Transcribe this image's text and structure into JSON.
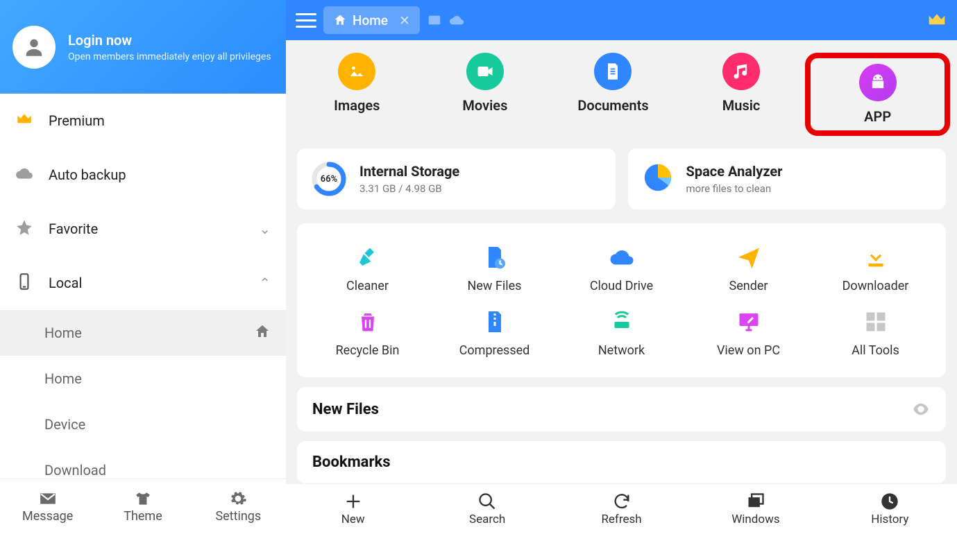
{
  "sidebar": {
    "login_title": "Login now",
    "login_sub": "Open members immediately enjoy all privileges",
    "items": [
      {
        "id": "premium",
        "label": "Premium"
      },
      {
        "id": "autobackup",
        "label": "Auto backup"
      },
      {
        "id": "favorite",
        "label": "Favorite"
      },
      {
        "id": "local",
        "label": "Local"
      }
    ],
    "local_children": [
      {
        "id": "home1",
        "label": "Home",
        "active": true
      },
      {
        "id": "home2",
        "label": "Home"
      },
      {
        "id": "device",
        "label": "Device"
      },
      {
        "id": "download",
        "label": "Download"
      }
    ],
    "footer": [
      {
        "id": "message",
        "label": "Message"
      },
      {
        "id": "theme",
        "label": "Theme"
      },
      {
        "id": "settings",
        "label": "Settings"
      }
    ]
  },
  "topbar": {
    "tab_label": "Home"
  },
  "categories": [
    {
      "id": "images",
      "label": "Images",
      "color": "#ffb300"
    },
    {
      "id": "movies",
      "label": "Movies",
      "color": "#18c99b"
    },
    {
      "id": "documents",
      "label": "Documents",
      "color": "#2f86ff"
    },
    {
      "id": "music",
      "label": "Music",
      "color": "#ff2d6b"
    },
    {
      "id": "app",
      "label": "APP",
      "color": "#c53cf0",
      "highlight": true
    }
  ],
  "storage": {
    "title": "Internal Storage",
    "used": "3.31 GB",
    "total": "4.98 GB",
    "sub": "3.31 GB / 4.98 GB",
    "percent": 66,
    "percent_label": "66%"
  },
  "analyzer": {
    "title": "Space Analyzer",
    "sub": "more files to clean"
  },
  "tools": [
    [
      {
        "id": "cleaner",
        "label": "Cleaner"
      },
      {
        "id": "newfiles",
        "label": "New Files"
      },
      {
        "id": "clouddrive",
        "label": "Cloud Drive"
      },
      {
        "id": "sender",
        "label": "Sender"
      },
      {
        "id": "downloader",
        "label": "Downloader"
      }
    ],
    [
      {
        "id": "recyclebin",
        "label": "Recycle Bin"
      },
      {
        "id": "compressed",
        "label": "Compressed"
      },
      {
        "id": "network",
        "label": "Network"
      },
      {
        "id": "viewonpc",
        "label": "View on PC"
      },
      {
        "id": "alltools",
        "label": "All Tools"
      }
    ]
  ],
  "sections": {
    "newfiles": "New Files",
    "bookmarks": "Bookmarks"
  },
  "bottombar": [
    {
      "id": "new",
      "label": "New"
    },
    {
      "id": "search",
      "label": "Search"
    },
    {
      "id": "refresh",
      "label": "Refresh"
    },
    {
      "id": "windows",
      "label": "Windows"
    },
    {
      "id": "history",
      "label": "History"
    }
  ]
}
